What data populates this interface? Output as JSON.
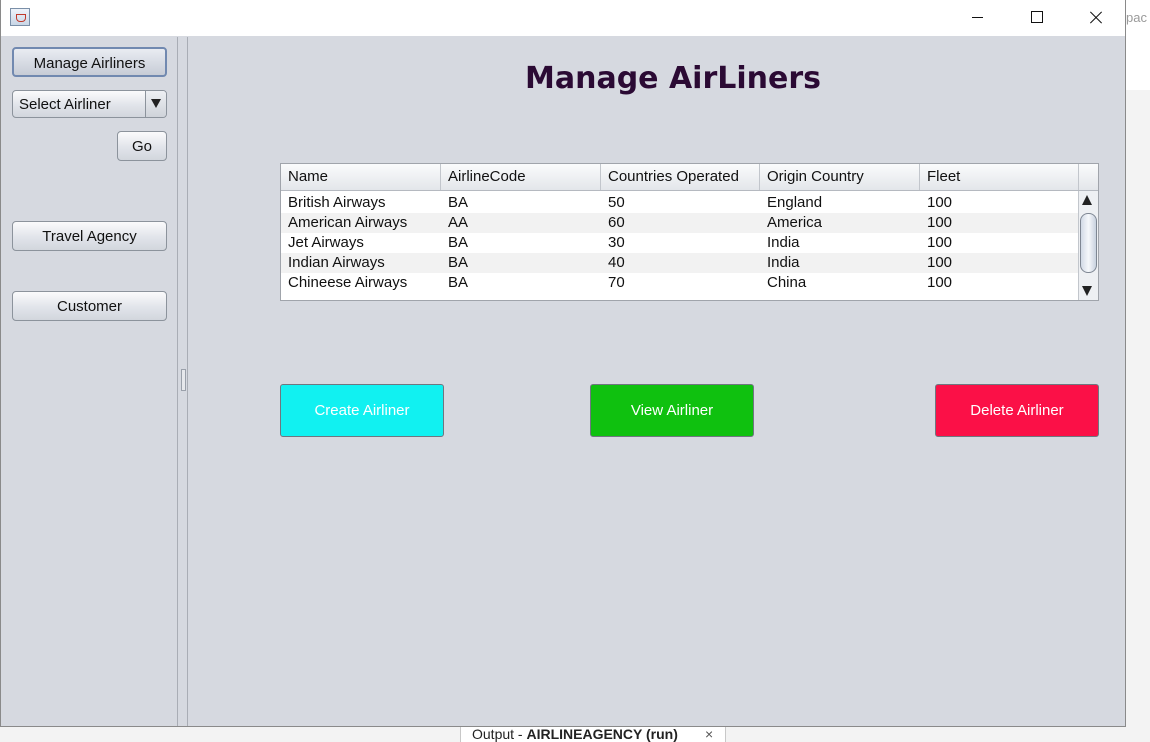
{
  "background_ide": {
    "right_edge_text": "pac",
    "output_tab": {
      "prefix": "Output - ",
      "project": "AIRLINEAGENCY (run)",
      "close_glyph": "×"
    }
  },
  "window": {
    "icon": "java-cup-icon"
  },
  "sidebar": {
    "manage_airliners_label": "Manage Airliners",
    "select_airliner_value": "Select Airliner",
    "go_label": "Go",
    "travel_agency_label": "Travel Agency",
    "customer_label": "Customer"
  },
  "main": {
    "title": "Manage AirLiners",
    "table": {
      "columns": [
        "Name",
        "AirlineCode",
        "Countries Operated",
        "Origin Country",
        "Fleet"
      ],
      "rows": [
        [
          "British Airways",
          "BA",
          "50",
          "England",
          "100"
        ],
        [
          "American Airways",
          "AA",
          "60",
          "America",
          "100"
        ],
        [
          "Jet Airways",
          "BA",
          "30",
          "India",
          "100"
        ],
        [
          "Indian Airways",
          "BA",
          "40",
          "India",
          "100"
        ],
        [
          "Chineese Airways",
          "BA",
          "70",
          "China",
          "100"
        ]
      ]
    },
    "buttons": {
      "create_label": "Create Airliner",
      "view_label": "View Airliner",
      "delete_label": "Delete Airliner"
    }
  },
  "colors": {
    "title": "#2b0a34",
    "create": "#11f1f1",
    "view": "#0fc10f",
    "delete": "#fb1047",
    "panel_bg": "#d6d9e0"
  }
}
